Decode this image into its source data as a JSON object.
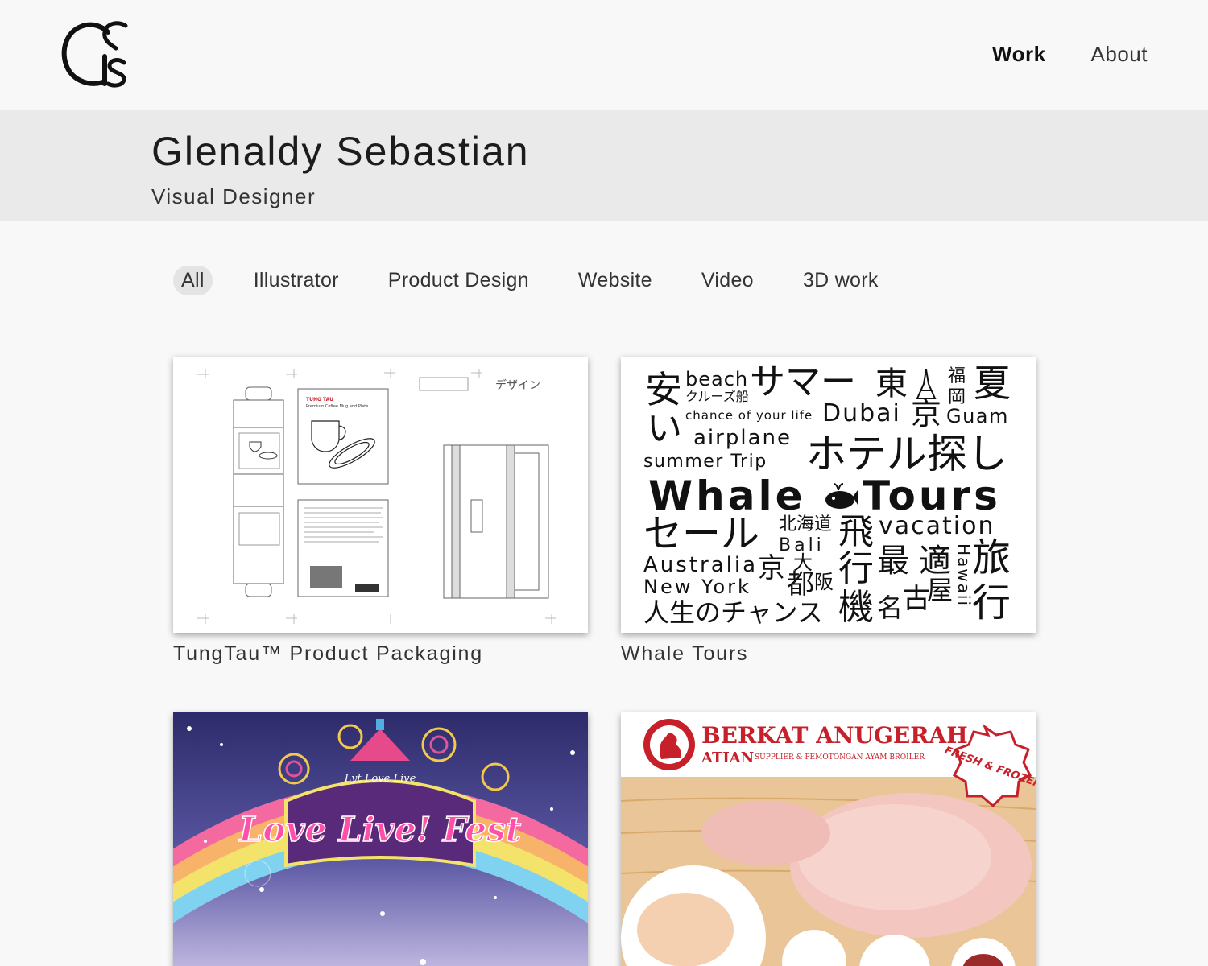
{
  "nav": {
    "items": [
      {
        "label": "Work",
        "active": true
      },
      {
        "label": "About",
        "active": false
      }
    ]
  },
  "hero": {
    "name": "Glenaldy Sebastian",
    "role": "Visual Designer"
  },
  "filters": [
    "All",
    "Illustrator",
    "Product Design",
    "Website",
    "Video",
    "3D work"
  ],
  "active_filter": "All",
  "projects": [
    {
      "title": "TungTau™ Product Packaging",
      "packaging_brand": "TUNG TAU",
      "packaging_text": "Premium Coffee Mug and Plate",
      "packaging_label": "デザイン"
    },
    {
      "title": "Whale Tours"
    },
    {
      "title": "",
      "banner_text": "Love Live! Fest",
      "banner_sub": "Lyt Love Live"
    },
    {
      "title": "",
      "brand": "BERKAT ANUGERAH",
      "brand_sub": "ATIAN",
      "brand_tagline": "SUPPLIER & PEMOTONGAN AYAM BROILER",
      "badge": "FRESH & FROZEN"
    }
  ],
  "whale_words": {
    "w1": "安",
    "w2": "beach",
    "w3": "サマー",
    "w4": "東",
    "w5": "福",
    "w6": "夏",
    "w7": "クルーズ船",
    "w8": "岡",
    "w9": "い",
    "w10": "chance of your life",
    "w11": "Dubai",
    "w12": "京",
    "w13": "Guam",
    "w14": "airplane",
    "w15": "summer Trip",
    "w16": "ホテル探し",
    "w17": "Whale",
    "w18": "Tours",
    "w19": "セール",
    "w20": "北海道",
    "w21": "Bali",
    "w22": "飛",
    "w23": "vacation",
    "w24": "Australia",
    "w25": "京",
    "w26": "大",
    "w27": "阪",
    "w28": "都",
    "w29": "行",
    "w30": "最",
    "w31": "適",
    "w32": "Hawaii",
    "w33": "旅",
    "w34": "New York",
    "w35": "人生のチャンス",
    "w36": "機",
    "w37": "名",
    "w38": "古",
    "w39": "屋",
    "w40": "行"
  },
  "colors": {
    "background": "#f8f8f8",
    "hero_band": "#eaeaea",
    "active_filter_bg": "#e4e4e4",
    "berkat_red": "#c8202b"
  }
}
